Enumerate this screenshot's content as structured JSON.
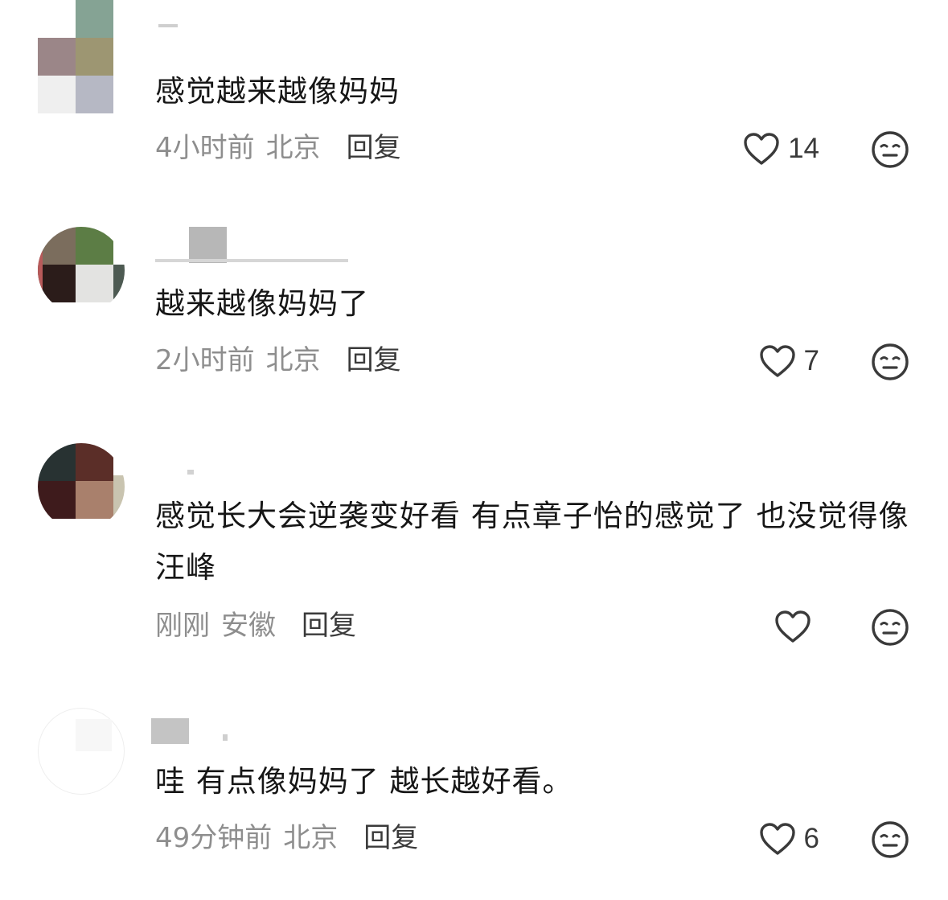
{
  "comments": [
    {
      "text": "感觉越来越像妈妈",
      "time": "4小时前",
      "location": "北京",
      "reply": "回复",
      "likes": "14"
    },
    {
      "text": "越来越像妈妈了",
      "time": "2小时前",
      "location": "北京",
      "reply": "回复",
      "likes": "7"
    },
    {
      "text": "感觉长大会逆袭变好看 有点章子怡的感觉了 也没觉得像汪峰",
      "time": "刚刚",
      "location": "安徽",
      "reply": "回复",
      "likes": ""
    },
    {
      "text": "哇 有点像妈妈了 越长越好看。",
      "time": "49分钟前",
      "location": "北京",
      "reply": "回复",
      "likes": "6"
    }
  ],
  "icons": {
    "like": "heart-outline-icon",
    "dislike": "meh-face-icon"
  },
  "colors": {
    "text": "#161616",
    "meta": "#8e8e8e",
    "reply": "#3a3a3a",
    "icon": "#3a3a3a"
  }
}
